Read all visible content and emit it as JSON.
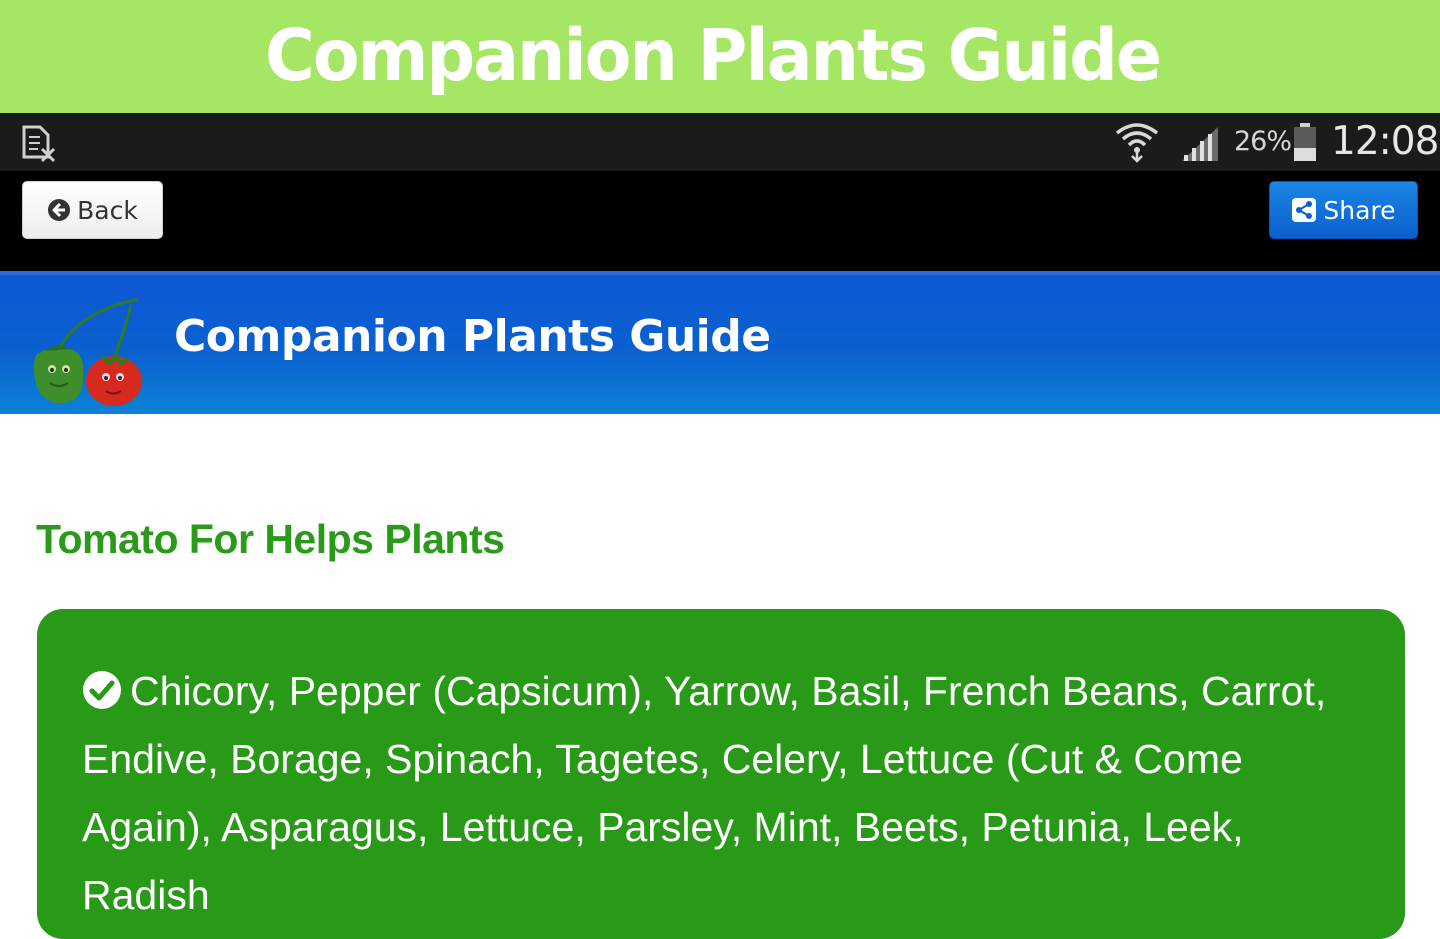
{
  "banner": {
    "title": "Companion Plants Guide"
  },
  "status_bar": {
    "left_icon": "sim-card-x-icon",
    "wifi_icon": "wifi-icon",
    "signal_icon": "signal-icon",
    "battery_percent": "26%",
    "battery_icon": "battery-icon",
    "time": "12:08"
  },
  "toolbar": {
    "back_label": "Back",
    "back_icon": "arrow-left-circle-icon",
    "share_label": "Share",
    "share_icon": "share-icon"
  },
  "header": {
    "title": "Companion Plants Guide",
    "logo": "pepper-tomato-logo"
  },
  "content": {
    "heading": "Tomato For Helps Plants",
    "check_icon": "check-circle-icon",
    "plants_text": "Chicory, Pepper (Capsicum), Yarrow, Basil, French Beans, Carrot, Endive, Borage, Spinach, Tagetes, Celery, Lettuce (Cut & Come Again), Asparagus, Lettuce, Parsley, Mint, Beets, Petunia, Leek, Radish"
  },
  "colors": {
    "banner_bg": "#a6e665",
    "header_blue": "#0a61cf",
    "heading_green": "#2a9a19",
    "card_green": "#299a18"
  }
}
